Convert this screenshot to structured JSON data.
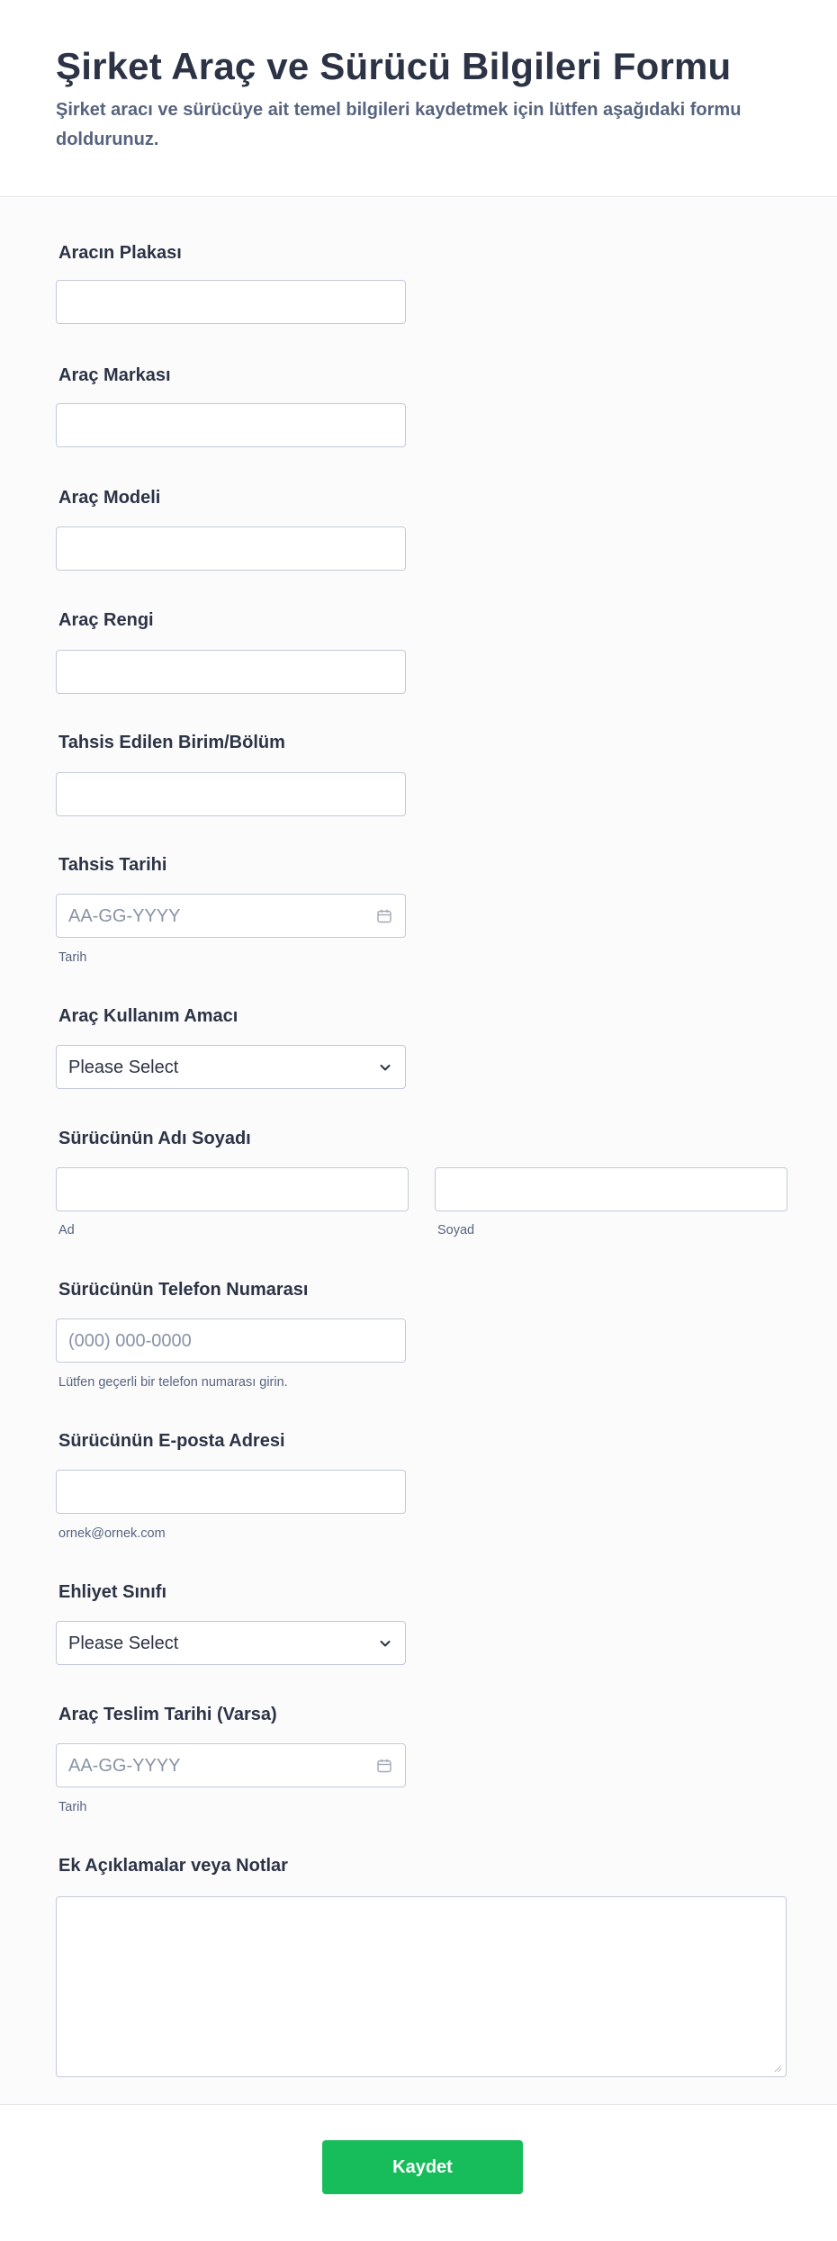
{
  "form": {
    "title": "Şirket Araç ve Sürücü Bilgileri Formu",
    "description": "Şirket aracı ve sürücüye ait temel bilgileri kaydetmek için lütfen aşağıdaki formu doldurunuz."
  },
  "fields": {
    "plate": {
      "label": "Aracın Plakası",
      "value": ""
    },
    "brand": {
      "label": "Araç Markası",
      "value": ""
    },
    "model": {
      "label": "Araç Modeli",
      "value": ""
    },
    "color": {
      "label": "Araç Rengi",
      "value": ""
    },
    "unit": {
      "label": "Tahsis Edilen Birim/Bölüm",
      "value": ""
    },
    "assign_date": {
      "label": "Tahsis Tarihi",
      "placeholder": "AA-GG-YYYY",
      "sublabel": "Tarih",
      "icon": "calendar-icon"
    },
    "purpose": {
      "label": "Araç Kullanım Amacı",
      "selected": "Please Select",
      "icon": "chevron-down-icon"
    },
    "driver_name": {
      "label": "Sürücünün Adı Soyadı",
      "first_sublabel": "Ad",
      "last_sublabel": "Soyad"
    },
    "phone": {
      "label": "Sürücünün Telefon Numarası",
      "placeholder": "(000) 000-0000",
      "sublabel": "Lütfen geçerli bir telefon numarası girin."
    },
    "email": {
      "label": "Sürücünün E-posta Adresi",
      "sublabel": "ornek@ornek.com"
    },
    "license": {
      "label": "Ehliyet Sınıfı",
      "selected": "Please Select",
      "icon": "chevron-down-icon"
    },
    "delivery_date": {
      "label": "Araç Teslim Tarihi (Varsa)",
      "placeholder": "AA-GG-YYYY",
      "sublabel": "Tarih",
      "icon": "calendar-icon"
    },
    "notes": {
      "label": "Ek Açıklamalar veya Notlar",
      "value": ""
    }
  },
  "submit": {
    "label": "Kaydet",
    "color": "#18bd5b"
  },
  "colors": {
    "text": "#2c3345",
    "muted": "#57647e",
    "border": "#c3cad8",
    "background": "#fbfbfc"
  }
}
